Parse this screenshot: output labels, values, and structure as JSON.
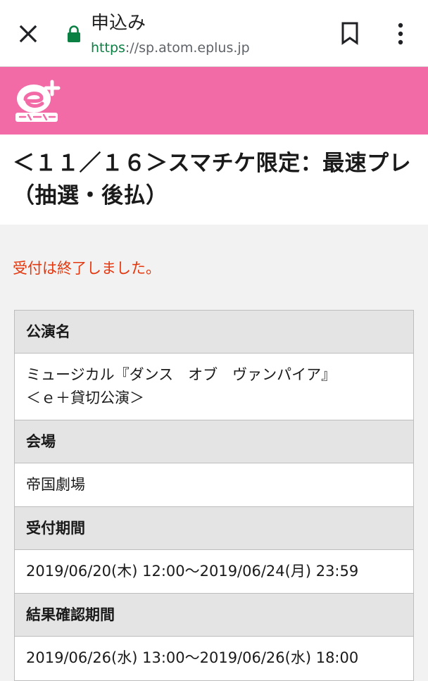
{
  "browser": {
    "page_title": "申込み",
    "url_scheme": "https",
    "url_rest": "://sp.atom.eplus.jp"
  },
  "site": {
    "logo_icon": "eplus-logo-icon",
    "brand_color": "#f26aa6"
  },
  "title": "＜１１／１６＞スマチケ限定：最速プレ　（抽選・後払）",
  "notice": "受付は終了しました。",
  "info": {
    "performance_label": "公演名",
    "performance_line1": "ミュージカル『ダンス　オブ　ヴァンパイア』",
    "performance_line2": "＜ｅ＋貸切公演＞",
    "venue_label": "会場",
    "venue_value": "帝国劇場",
    "reception_label": "受付期間",
    "reception_value": "2019/06/20(木) 12:00〜2019/06/24(月) 23:59",
    "result_label": "結果確認期間",
    "result_value": "2019/06/26(水) 13:00〜2019/06/26(水) 18:00"
  },
  "colors": {
    "notice": "#e3380f",
    "secure": "#0b8043"
  }
}
